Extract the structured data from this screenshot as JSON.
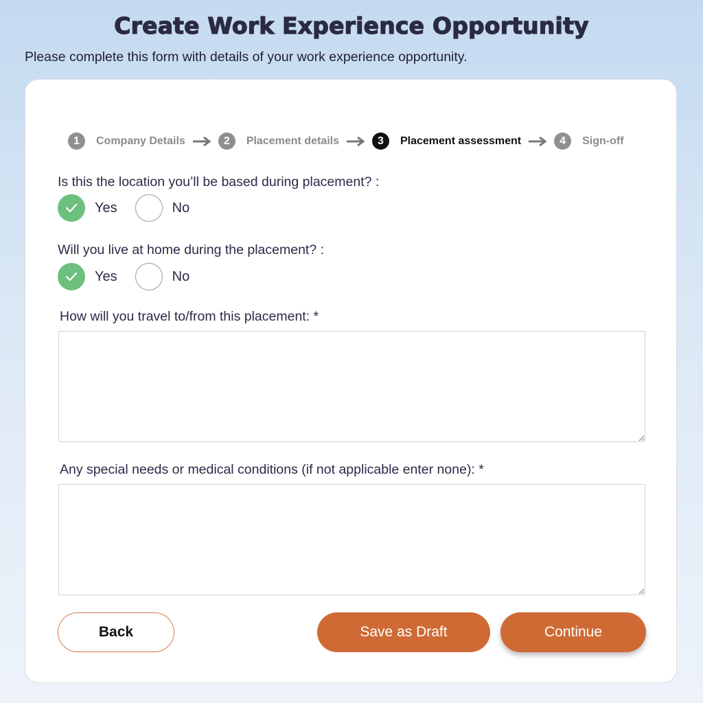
{
  "header": {
    "title": "Create Work Experience Opportunity",
    "intro": "Please complete this form with details of your work experience opportunity."
  },
  "stepper": {
    "steps": [
      {
        "number": "1",
        "label": "Company Details",
        "active": false
      },
      {
        "number": "2",
        "label": "Placement details",
        "active": false
      },
      {
        "number": "3",
        "label": "Placement assessment",
        "active": true
      },
      {
        "number": "4",
        "label": "Sign-off",
        "active": false
      }
    ]
  },
  "form": {
    "q_location": {
      "label": "Is this the location you’ll be based during placement? :",
      "options": [
        "Yes",
        "No"
      ],
      "selected": "Yes"
    },
    "q_home": {
      "label": "Will you live at home during the placement? :",
      "options": [
        "Yes",
        "No"
      ],
      "selected": "Yes"
    },
    "travel": {
      "label": "How will you travel to/from this placement: *",
      "value": ""
    },
    "special_needs": {
      "label": "Any special needs or medical conditions (if not applicable enter none): *",
      "value": ""
    }
  },
  "buttons": {
    "back": "Back",
    "save_draft": "Save as Draft",
    "continue": "Continue"
  },
  "colors": {
    "accent": "#cf6a35",
    "checked": "#6cbf7d",
    "active_step": "#111111",
    "inactive_step": "#8e8e93"
  }
}
